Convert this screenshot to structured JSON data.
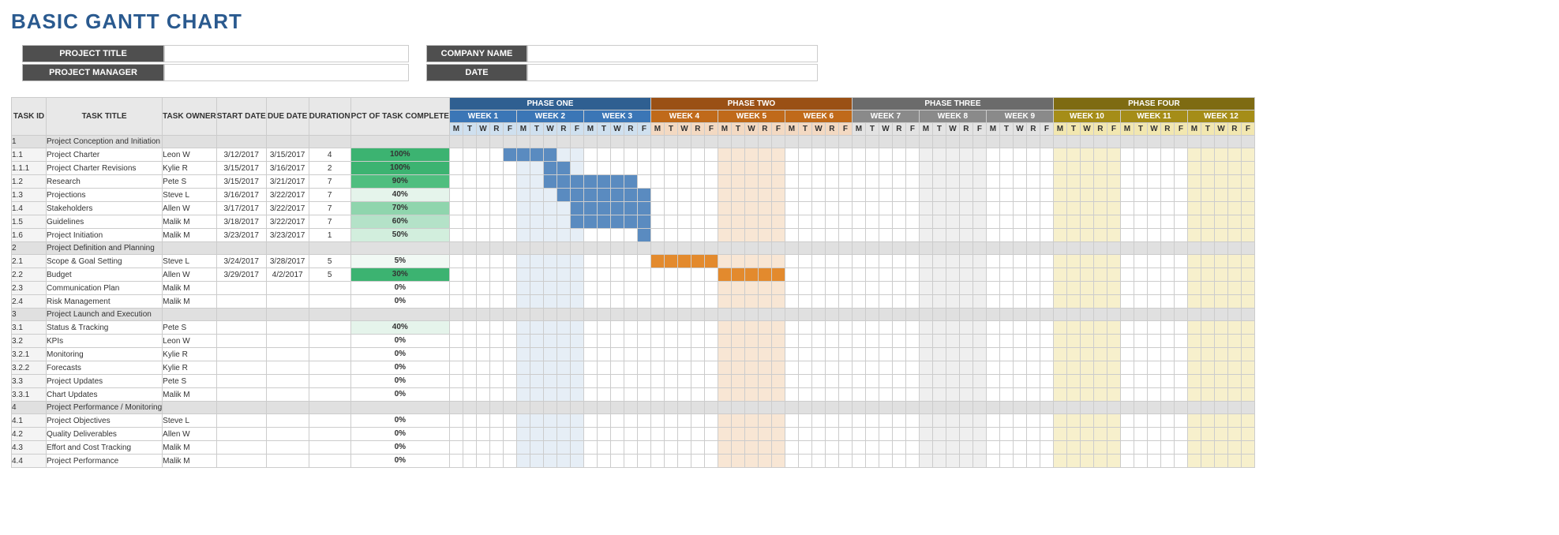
{
  "title": "BASIC GANTT CHART",
  "meta": {
    "labels": {
      "project_title": "PROJECT TITLE",
      "company_name": "COMPANY NAME",
      "project_manager": "PROJECT MANAGER",
      "date": "DATE"
    },
    "values": {
      "project_title": "",
      "company_name": "",
      "project_manager": "",
      "date": ""
    }
  },
  "columns": {
    "task_id": "TASK ID",
    "task_title": "TASK TITLE",
    "task_owner": "TASK OWNER",
    "start_date": "START DATE",
    "due_date": "DUE  DATE",
    "duration": "DURATION",
    "pct": "PCT OF TASK COMPLETE"
  },
  "phases": [
    {
      "name": "PHASE ONE",
      "weeks": [
        "WEEK 1",
        "WEEK 2",
        "WEEK 3"
      ],
      "cls": "ph1"
    },
    {
      "name": "PHASE TWO",
      "weeks": [
        "WEEK 4",
        "WEEK 5",
        "WEEK 6"
      ],
      "cls": "ph2"
    },
    {
      "name": "PHASE THREE",
      "weeks": [
        "WEEK 7",
        "WEEK 8",
        "WEEK 9"
      ],
      "cls": "ph3"
    },
    {
      "name": "PHASE FOUR",
      "weeks": [
        "WEEK 10",
        "WEEK 11",
        "WEEK 12"
      ],
      "cls": "ph4"
    }
  ],
  "days": [
    "M",
    "T",
    "W",
    "R",
    "F"
  ],
  "pct_colors": [
    [
      100,
      "#3cb371"
    ],
    [
      90,
      "#4fbe7f"
    ],
    [
      70,
      "#8fd5ad"
    ],
    [
      60,
      "#b4e2c8"
    ],
    [
      50,
      "#d2eedd"
    ],
    [
      40,
      "#e5f4eb"
    ],
    [
      30,
      "#3cb371"
    ],
    [
      5,
      "#f1f9f4"
    ],
    [
      0,
      "#ffffff"
    ]
  ],
  "rows": [
    {
      "id": "1",
      "title": "Project Conception and Initiation",
      "section": true
    },
    {
      "id": "1.1",
      "title": "Project Charter",
      "owner": "Leon W",
      "start": "3/12/2017",
      "due": "3/15/2017",
      "dur": "4",
      "pct": 100,
      "bar": [
        5,
        8
      ],
      "barcls": "bar1"
    },
    {
      "id": "1.1.1",
      "title": "Project Charter Revisions",
      "owner": "Kylie R",
      "start": "3/15/2017",
      "due": "3/16/2017",
      "dur": "2",
      "pct": 100,
      "bar": [
        8,
        9
      ],
      "barcls": "bar1"
    },
    {
      "id": "1.2",
      "title": "Research",
      "owner": "Pete S",
      "start": "3/15/2017",
      "due": "3/21/2017",
      "dur": "7",
      "pct": 90,
      "bar": [
        8,
        14
      ],
      "barcls": "bar1"
    },
    {
      "id": "1.3",
      "title": "Projections",
      "owner": "Steve L",
      "start": "3/16/2017",
      "due": "3/22/2017",
      "dur": "7",
      "pct": 40,
      "bar": [
        9,
        15
      ],
      "barcls": "bar1"
    },
    {
      "id": "1.4",
      "title": "Stakeholders",
      "owner": "Allen W",
      "start": "3/17/2017",
      "due": "3/22/2017",
      "dur": "7",
      "pct": 70,
      "bar": [
        10,
        15
      ],
      "barcls": "bar1"
    },
    {
      "id": "1.5",
      "title": "Guidelines",
      "owner": "Malik M",
      "start": "3/18/2017",
      "due": "3/22/2017",
      "dur": "7",
      "pct": 60,
      "bar": [
        10,
        15
      ],
      "barcls": "bar1"
    },
    {
      "id": "1.6",
      "title": "Project Initiation",
      "owner": "Malik M",
      "start": "3/23/2017",
      "due": "3/23/2017",
      "dur": "1",
      "pct": 50,
      "bar": [
        15,
        15
      ],
      "barcls": "bar1"
    },
    {
      "id": "2",
      "title": "Project Definition and Planning",
      "section": true
    },
    {
      "id": "2.1",
      "title": "Scope & Goal Setting",
      "owner": "Steve L",
      "start": "3/24/2017",
      "due": "3/28/2017",
      "dur": "5",
      "pct": 5,
      "bar": [
        16,
        20
      ],
      "barcls": "bar2"
    },
    {
      "id": "2.2",
      "title": "Budget",
      "owner": "Allen W",
      "start": "3/29/2017",
      "due": "4/2/2017",
      "dur": "5",
      "pct": 30,
      "bar": [
        21,
        25
      ],
      "barcls": "bar2"
    },
    {
      "id": "2.3",
      "title": "Communication Plan",
      "owner": "Malik M",
      "pct": 0
    },
    {
      "id": "2.4",
      "title": "Risk Management",
      "owner": "Malik M",
      "pct": 0
    },
    {
      "id": "3",
      "title": "Project Launch and Execution",
      "section": true
    },
    {
      "id": "3.1",
      "title": "Status & Tracking",
      "owner": "Pete S",
      "pct": 40
    },
    {
      "id": "3.2",
      "title": "KPIs",
      "owner": "Leon W",
      "pct": 0
    },
    {
      "id": "3.2.1",
      "title": "Monitoring",
      "owner": "Kylie R",
      "pct": 0
    },
    {
      "id": "3.2.2",
      "title": "Forecasts",
      "owner": "Kylie R",
      "pct": 0
    },
    {
      "id": "3.3",
      "title": "Project Updates",
      "owner": "Pete S",
      "pct": 0
    },
    {
      "id": "3.3.1",
      "title": "Chart Updates",
      "owner": "Malik M",
      "pct": 0
    },
    {
      "id": "4",
      "title": "Project Performance / Monitoring",
      "section": true
    },
    {
      "id": "4.1",
      "title": "Project Objectives",
      "owner": "Steve L",
      "pct": 0
    },
    {
      "id": "4.2",
      "title": "Quality Deliverables",
      "owner": "Allen W",
      "pct": 0
    },
    {
      "id": "4.3",
      "title": "Effort and Cost Tracking",
      "owner": "Malik M",
      "pct": 0
    },
    {
      "id": "4.4",
      "title": "Project Performance",
      "owner": "Malik M",
      "pct": 0
    }
  ],
  "chart_data": {
    "type": "table",
    "title": "Basic Gantt Chart",
    "time_axis": {
      "unit": "workday",
      "labels_per_week": [
        "M",
        "T",
        "W",
        "R",
        "F"
      ],
      "weeks": 12,
      "phases": [
        {
          "name": "PHASE ONE",
          "weeks": [
            1,
            2,
            3
          ]
        },
        {
          "name": "PHASE TWO",
          "weeks": [
            4,
            5,
            6
          ]
        },
        {
          "name": "PHASE THREE",
          "weeks": [
            7,
            8,
            9
          ]
        },
        {
          "name": "PHASE FOUR",
          "weeks": [
            10,
            11,
            12
          ]
        }
      ]
    },
    "tasks": [
      {
        "id": "1.1",
        "title": "Project Charter",
        "owner": "Leon W",
        "start": "3/12/2017",
        "due": "3/15/2017",
        "duration": 4,
        "pct_complete": 100,
        "bar_days": [
          5,
          8
        ]
      },
      {
        "id": "1.1.1",
        "title": "Project Charter Revisions",
        "owner": "Kylie R",
        "start": "3/15/2017",
        "due": "3/16/2017",
        "duration": 2,
        "pct_complete": 100,
        "bar_days": [
          8,
          9
        ]
      },
      {
        "id": "1.2",
        "title": "Research",
        "owner": "Pete S",
        "start": "3/15/2017",
        "due": "3/21/2017",
        "duration": 7,
        "pct_complete": 90,
        "bar_days": [
          8,
          14
        ]
      },
      {
        "id": "1.3",
        "title": "Projections",
        "owner": "Steve L",
        "start": "3/16/2017",
        "due": "3/22/2017",
        "duration": 7,
        "pct_complete": 40,
        "bar_days": [
          9,
          15
        ]
      },
      {
        "id": "1.4",
        "title": "Stakeholders",
        "owner": "Allen W",
        "start": "3/17/2017",
        "due": "3/22/2017",
        "duration": 7,
        "pct_complete": 70,
        "bar_days": [
          10,
          15
        ]
      },
      {
        "id": "1.5",
        "title": "Guidelines",
        "owner": "Malik M",
        "start": "3/18/2017",
        "due": "3/22/2017",
        "duration": 7,
        "pct_complete": 60,
        "bar_days": [
          10,
          15
        ]
      },
      {
        "id": "1.6",
        "title": "Project Initiation",
        "owner": "Malik M",
        "start": "3/23/2017",
        "due": "3/23/2017",
        "duration": 1,
        "pct_complete": 50,
        "bar_days": [
          15,
          15
        ]
      },
      {
        "id": "2.1",
        "title": "Scope & Goal Setting",
        "owner": "Steve L",
        "start": "3/24/2017",
        "due": "3/28/2017",
        "duration": 5,
        "pct_complete": 5,
        "bar_days": [
          16,
          20
        ]
      },
      {
        "id": "2.2",
        "title": "Budget",
        "owner": "Allen W",
        "start": "3/29/2017",
        "due": "4/2/2017",
        "duration": 5,
        "pct_complete": 30,
        "bar_days": [
          21,
          25
        ]
      },
      {
        "id": "2.3",
        "title": "Communication Plan",
        "owner": "Malik M",
        "pct_complete": 0
      },
      {
        "id": "2.4",
        "title": "Risk Management",
        "owner": "Malik M",
        "pct_complete": 0
      },
      {
        "id": "3.1",
        "title": "Status & Tracking",
        "owner": "Pete S",
        "pct_complete": 40
      },
      {
        "id": "3.2",
        "title": "KPIs",
        "owner": "Leon W",
        "pct_complete": 0
      },
      {
        "id": "3.2.1",
        "title": "Monitoring",
        "owner": "Kylie R",
        "pct_complete": 0
      },
      {
        "id": "3.2.2",
        "title": "Forecasts",
        "owner": "Kylie R",
        "pct_complete": 0
      },
      {
        "id": "3.3",
        "title": "Project Updates",
        "owner": "Pete S",
        "pct_complete": 0
      },
      {
        "id": "3.3.1",
        "title": "Chart Updates",
        "owner": "Malik M",
        "pct_complete": 0
      },
      {
        "id": "4.1",
        "title": "Project Objectives",
        "owner": "Steve L",
        "pct_complete": 0
      },
      {
        "id": "4.2",
        "title": "Quality Deliverables",
        "owner": "Allen W",
        "pct_complete": 0
      },
      {
        "id": "4.3",
        "title": "Effort and Cost Tracking",
        "owner": "Malik M",
        "pct_complete": 0
      },
      {
        "id": "4.4",
        "title": "Project Performance",
        "owner": "Malik M",
        "pct_complete": 0
      }
    ]
  }
}
